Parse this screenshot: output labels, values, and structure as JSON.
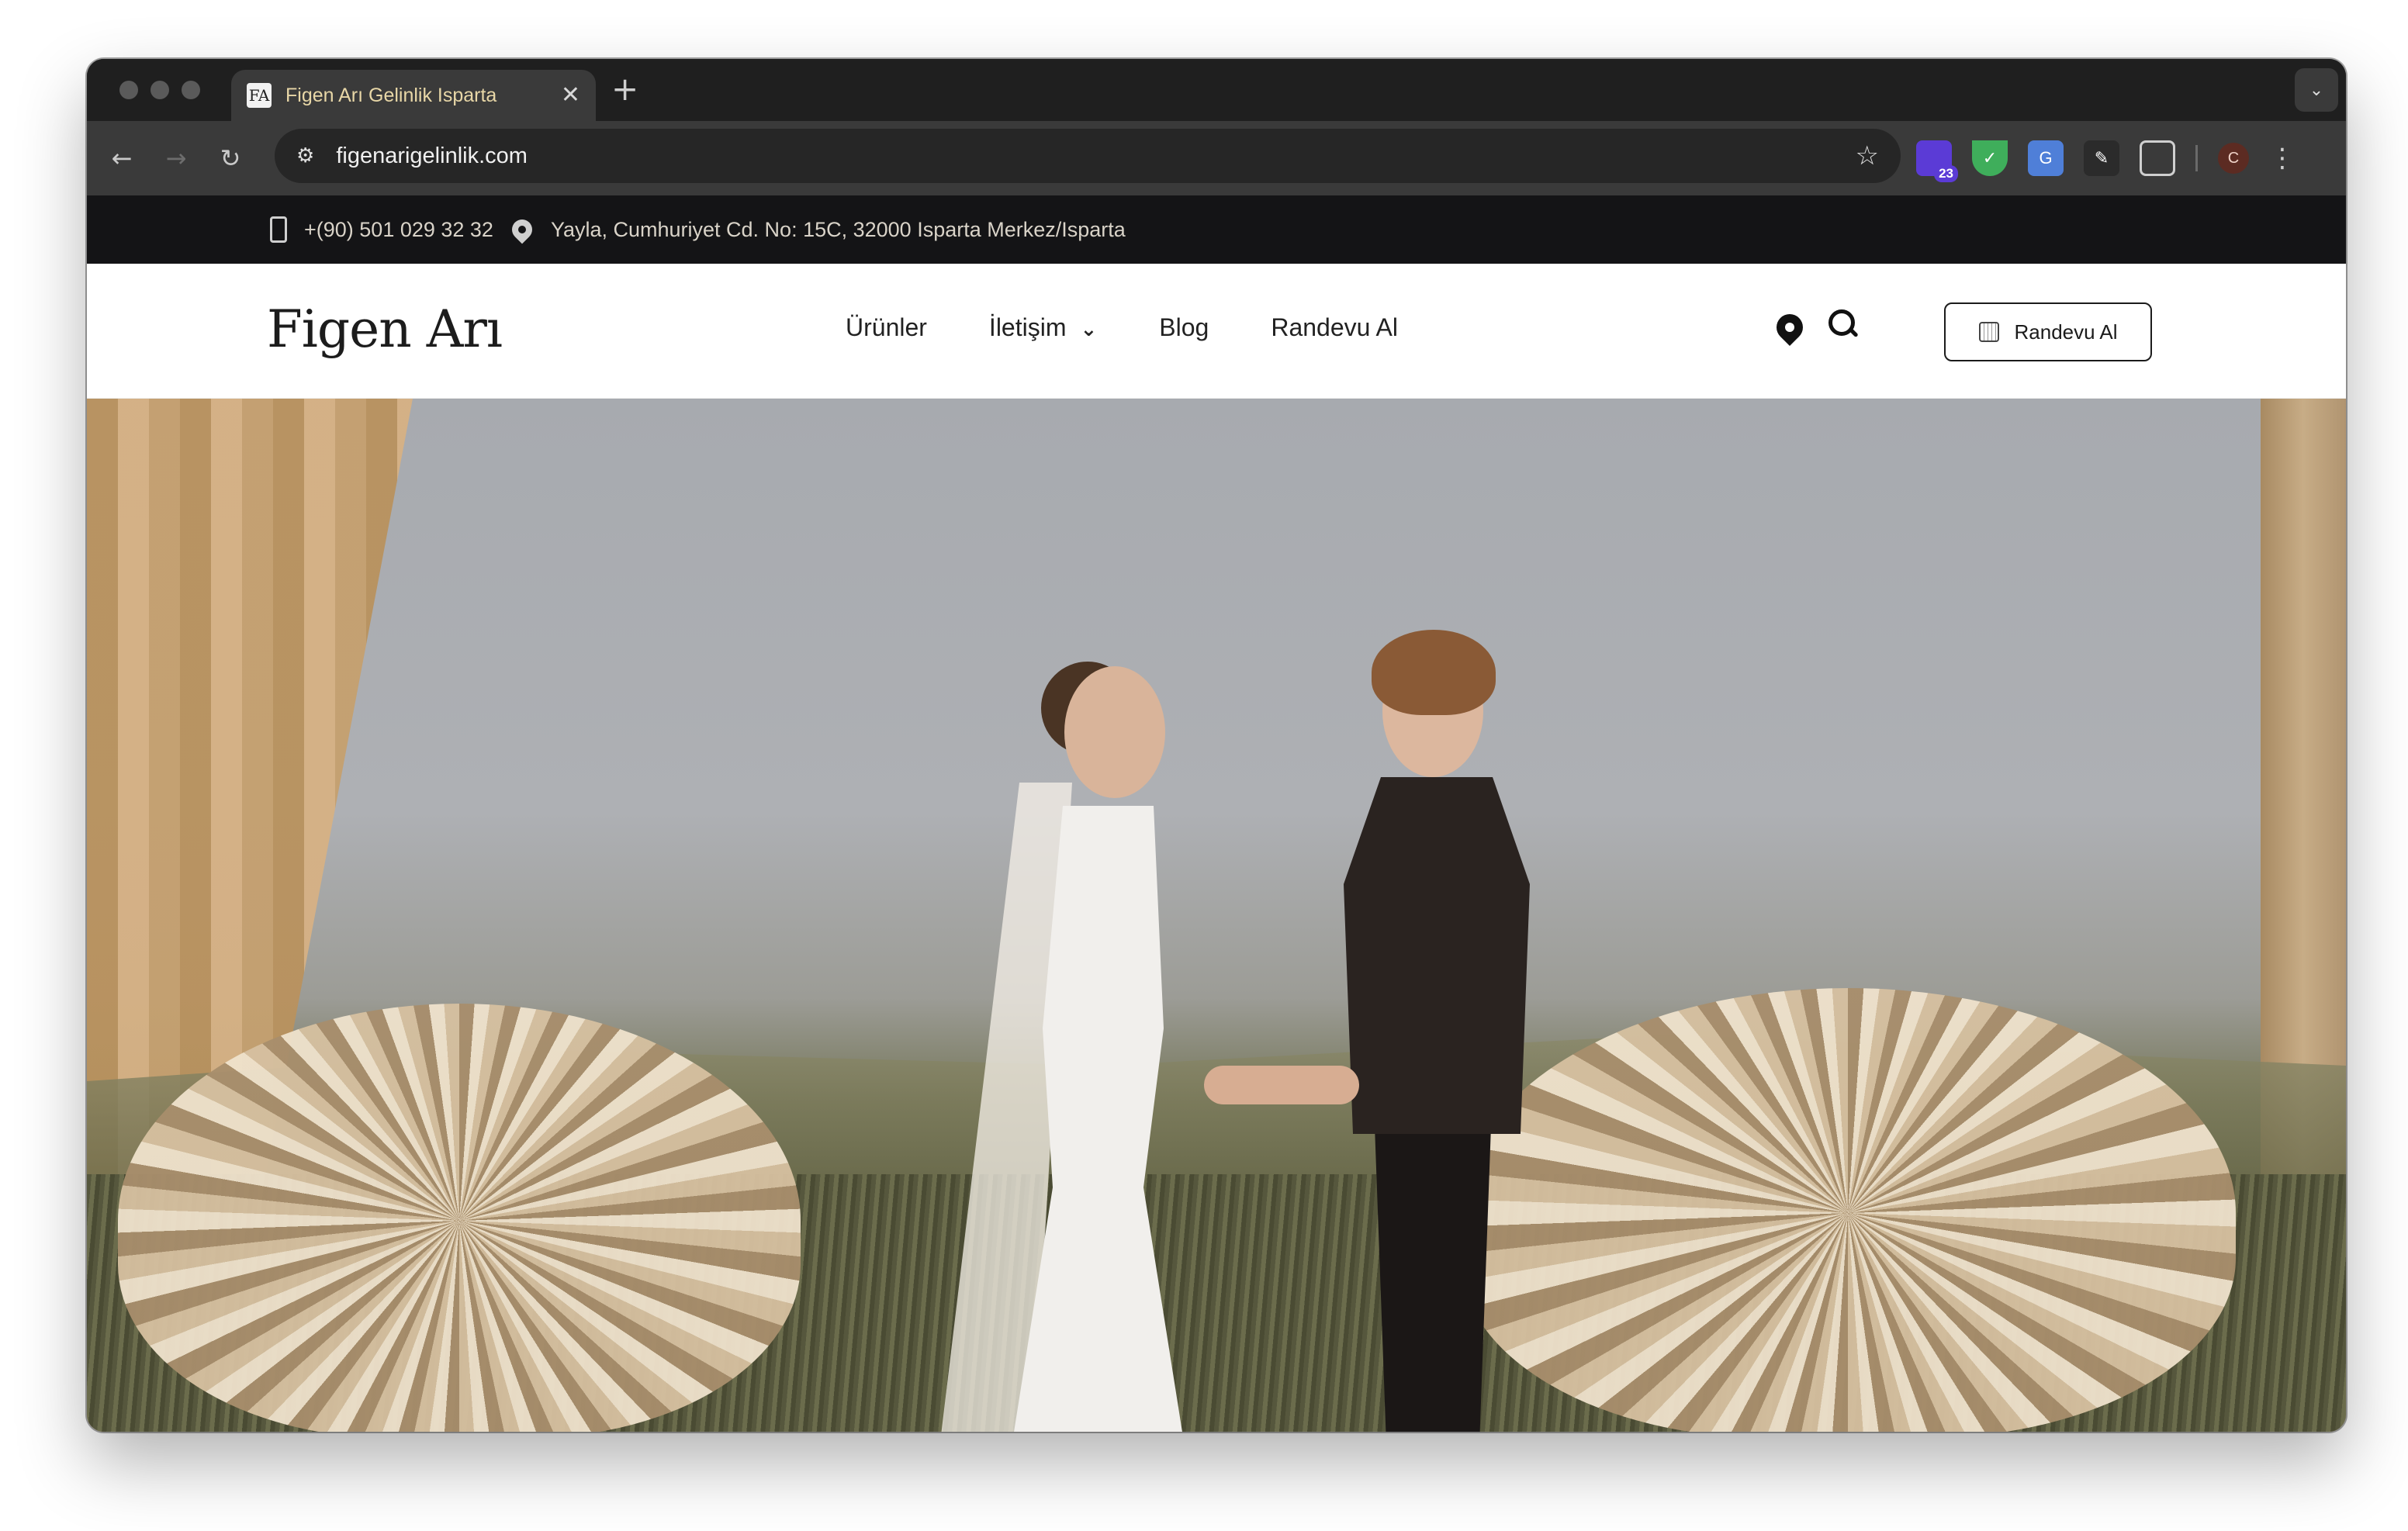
{
  "browser": {
    "tab": {
      "title": "Figen Arı Gelinlik Isparta",
      "favicon": "FA",
      "close": "✕"
    },
    "new_tab": "+",
    "url": "figenarigelinlik.com",
    "extensions": [
      {
        "name": "extension-icon-purple",
        "badge": "23",
        "color": "#5b3bd6"
      },
      {
        "name": "shield-extension-icon",
        "badge": "",
        "color": "#3fae5b"
      },
      {
        "name": "translate-extension-icon",
        "badge": "",
        "color": "#4f7fd8"
      },
      {
        "name": "pen-extension-icon",
        "badge": "",
        "color": "#2b2b2b"
      },
      {
        "name": "puzzle-extension-icon",
        "badge": "",
        "color": "transparent"
      }
    ],
    "profile_initial": "C"
  },
  "topbar": {
    "phone": "+(90) 501 029 32 32",
    "address": "Yayla, Cumhuriyet Cd. No: 15C, 32000 Isparta Merkez/Isparta"
  },
  "header": {
    "logo": "Figen Arı",
    "nav": [
      {
        "label": "Ürünler"
      },
      {
        "label": "İletişim"
      },
      {
        "label": "Blog"
      },
      {
        "label": "Randevu Al"
      }
    ],
    "cta_label": "Randevu Al"
  },
  "colors": {
    "topbar_bg": "#141416",
    "accent_tab_text": "#e8d7a7"
  }
}
